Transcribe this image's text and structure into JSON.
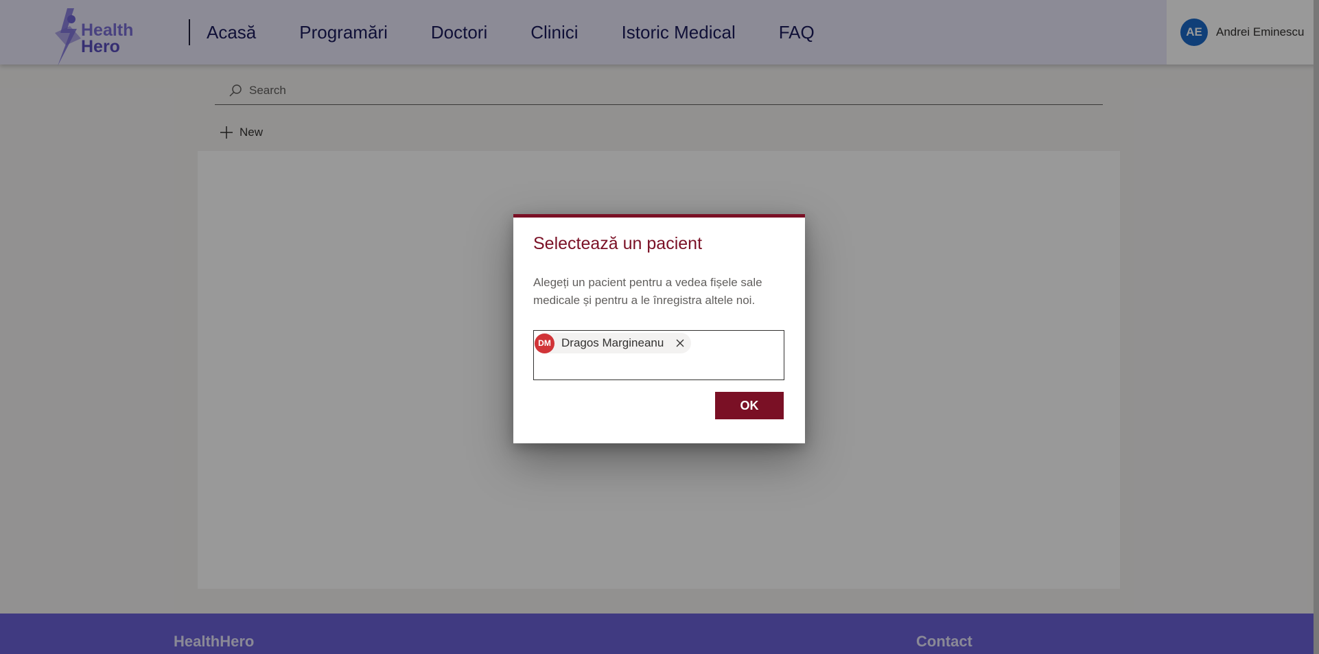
{
  "brand": {
    "line1": "Health",
    "line2": "Hero"
  },
  "nav": {
    "items": [
      {
        "label": "Acasă"
      },
      {
        "label": "Programări"
      },
      {
        "label": "Doctori"
      },
      {
        "label": "Clinici"
      },
      {
        "label": "Istoric Medical"
      },
      {
        "label": "FAQ"
      }
    ]
  },
  "user": {
    "initials": "AE",
    "name": "Andrei Eminescu"
  },
  "search": {
    "placeholder": "Search",
    "icon": "search-icon"
  },
  "toolbar": {
    "new_label": "New",
    "new_icon": "plus-icon"
  },
  "dialog": {
    "title": "Selectează un pacient",
    "description": "Alegeți un pacient pentru a vedea fișele sale medicale și pentru a le înregistra altele noi.",
    "selected_patient": {
      "initials": "DM",
      "name": "Dragos Margineanu"
    },
    "ok_label": "OK"
  },
  "footer": {
    "brand": "HealthHero",
    "contact": "Contact"
  },
  "colors": {
    "accent": "#7a1025",
    "header_bg": "#e9e8fb",
    "footer_bg": "#6b61d8",
    "user_avatar": "#1b6ac9",
    "patient_avatar": "#d13438"
  }
}
